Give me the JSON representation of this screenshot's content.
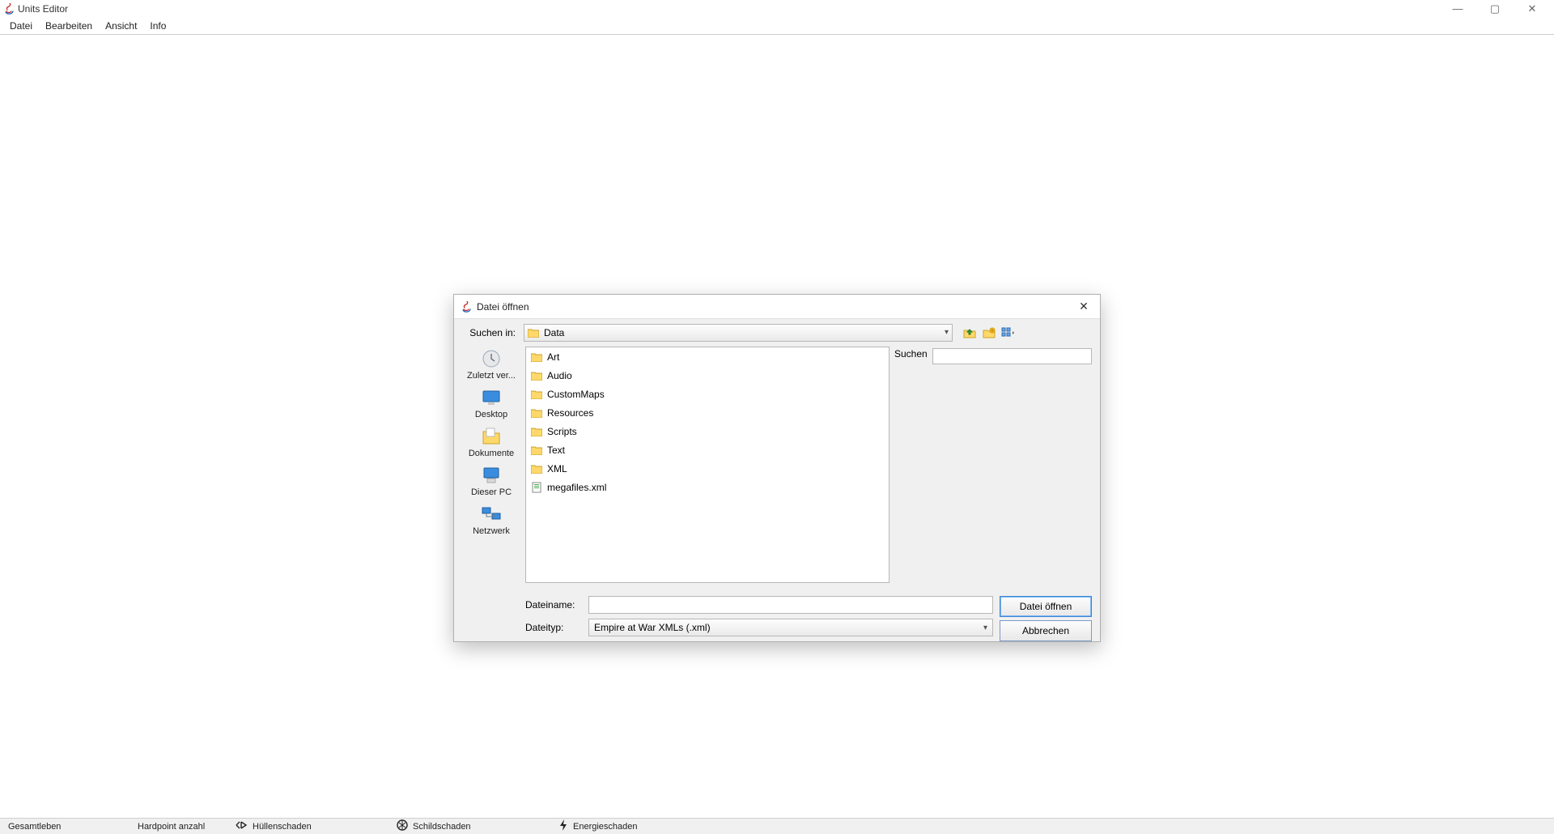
{
  "window": {
    "title": "Units Editor",
    "controls": {
      "min": "—",
      "max": "▢",
      "close": "✕"
    }
  },
  "menu": {
    "items": [
      "Datei",
      "Bearbeiten",
      "Ansicht",
      "Info"
    ]
  },
  "statusbar": {
    "total_life": "Gesamtleben",
    "hardpoint_count": "Hardpoint anzahl",
    "hull_damage": "Hüllenschaden",
    "shield_damage": "Schildschaden",
    "energy_damage": "Energieschaden"
  },
  "dialog": {
    "title": "Datei öffnen",
    "look_in_label": "Suchen in:",
    "look_in_value": "Data",
    "tool_icons": {
      "up": "up-folder-icon",
      "new": "new-folder-icon",
      "view": "view-menu-icon"
    },
    "places": [
      {
        "label": "Zuletzt ver...",
        "icon": "recent"
      },
      {
        "label": "Desktop",
        "icon": "desktop"
      },
      {
        "label": "Dokumente",
        "icon": "documents"
      },
      {
        "label": "Dieser PC",
        "icon": "thispc"
      },
      {
        "label": "Netzwerk",
        "icon": "network"
      }
    ],
    "files": [
      {
        "name": "Art",
        "type": "folder"
      },
      {
        "name": "Audio",
        "type": "folder"
      },
      {
        "name": "CustomMaps",
        "type": "folder"
      },
      {
        "name": "Resources",
        "type": "folder"
      },
      {
        "name": "Scripts",
        "type": "folder"
      },
      {
        "name": "Text",
        "type": "folder"
      },
      {
        "name": "XML",
        "type": "folder"
      },
      {
        "name": "megafiles.xml",
        "type": "file"
      }
    ],
    "search_label": "Suchen",
    "search_value": "",
    "filename_label": "Dateiname:",
    "filename_value": "",
    "filetype_label": "Dateityp:",
    "filetype_value": "Empire at War XMLs (.xml)",
    "open_button": "Datei öffnen",
    "cancel_button": "Abbrechen"
  }
}
